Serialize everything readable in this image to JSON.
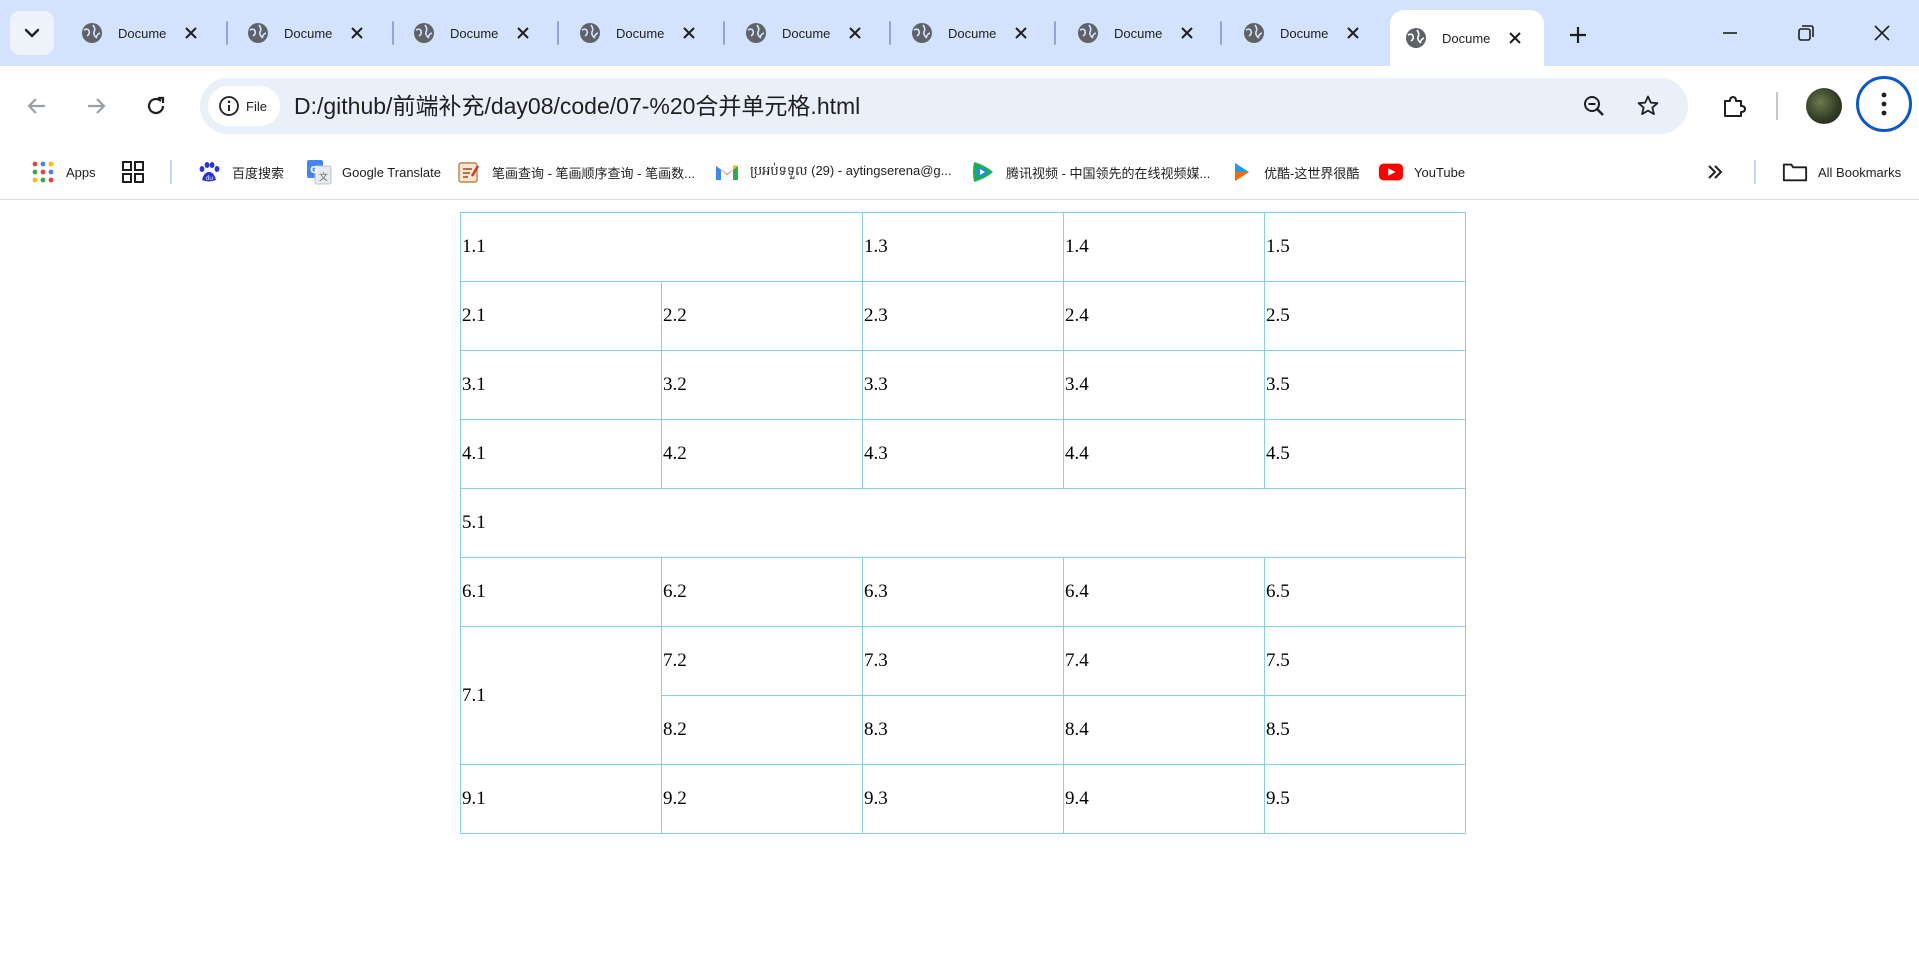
{
  "browser": {
    "tabs": [
      {
        "title": "Document",
        "active": false
      },
      {
        "title": "Document",
        "active": false
      },
      {
        "title": "Document",
        "active": false
      },
      {
        "title": "Document",
        "active": false
      },
      {
        "title": "Document",
        "active": false
      },
      {
        "title": "Document",
        "active": false
      },
      {
        "title": "Document",
        "active": false
      },
      {
        "title": "Document",
        "active": false
      },
      {
        "title": "Document",
        "active": true
      }
    ],
    "site_chip_label": "File",
    "url": "D:/github/前端补充/day08/code/07-%20合并单元格.html",
    "bookmarks": [
      {
        "label": "Apps",
        "icon": "apps-grid-icon"
      },
      {
        "label": "",
        "icon": "tab-groups-icon"
      },
      {
        "label": "百度搜索",
        "icon": "baidu-icon"
      },
      {
        "label": "Google Translate",
        "icon": "google-translate-icon"
      },
      {
        "label": "笔画查询 - 笔画顺序查询 - 笔画数...",
        "icon": "stroke-query-icon"
      },
      {
        "label": "ប្រអប់ទទួល (29) - aytingserena@g...",
        "icon": "gmail-icon"
      },
      {
        "label": "腾讯视频 - 中国领先的在线视频媒...",
        "icon": "tencent-video-icon"
      },
      {
        "label": "优酷-这世界很酷",
        "icon": "youku-icon"
      },
      {
        "label": "YouTube",
        "icon": "youtube-icon"
      }
    ],
    "all_bookmarks_label": "All Bookmarks"
  },
  "table": {
    "rows": [
      [
        "1.1",
        "1.3",
        "1.4",
        "1.5"
      ],
      [
        "2.1",
        "2.2",
        "2.3",
        "2.4",
        "2.5"
      ],
      [
        "3.1",
        "3.2",
        "3.3",
        "3.4",
        "3.5"
      ],
      [
        "4.1",
        "4.2",
        "4.3",
        "4.4",
        "4.5"
      ],
      [
        "5.1"
      ],
      [
        "6.1",
        "6.2",
        "6.3",
        "6.4",
        "6.5"
      ],
      [
        "7.1",
        "7.2",
        "7.3",
        "7.4",
        "7.5"
      ],
      [
        "8.2",
        "8.3",
        "8.4",
        "8.5"
      ],
      [
        "9.1",
        "9.2",
        "9.3",
        "9.4",
        "9.5"
      ]
    ]
  }
}
